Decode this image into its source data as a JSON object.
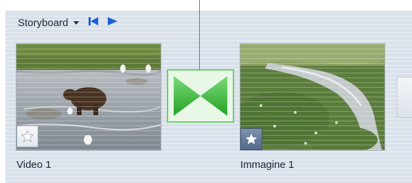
{
  "toolbar": {
    "title": "Storyboard",
    "icons": [
      "chevron-down-icon",
      "skip-to-start-icon",
      "play-icon"
    ]
  },
  "clips": [
    {
      "label": "Video 1",
      "type": "video",
      "badge": "star-icon"
    },
    {
      "label": "Immagine 1",
      "type": "image",
      "badge": "star-icon"
    }
  ],
  "transition": {
    "icon": "bowtie-transition-icon"
  },
  "colors": {
    "panel_bg": "#d9e1ea",
    "accent_blue": "#1b5fd6",
    "transition_green": "#3cb83a"
  }
}
